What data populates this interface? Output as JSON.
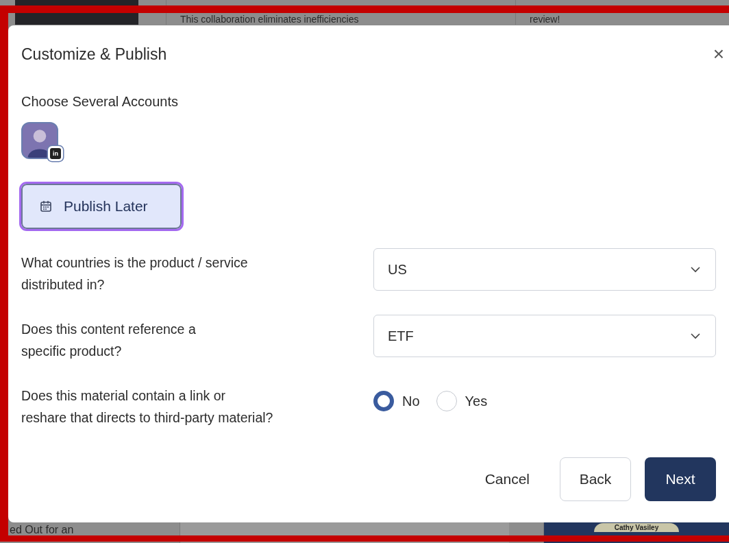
{
  "background": {
    "top_texts": [
      "This collaboration eliminates inefficiencies",
      "review!"
    ],
    "bottom_texts": [
      "ed Out for an",
      "Cathy Vasiley"
    ]
  },
  "dialog": {
    "title": "Customize & Publish",
    "close": "×",
    "accounts": {
      "label": "Choose Several Accounts",
      "items": [
        {
          "badge": "in",
          "selected": false
        }
      ]
    },
    "publish_later": {
      "label": "Publish Later",
      "focused": true
    },
    "questions": [
      {
        "kind": "select",
        "label_lines": [
          "What countries is the product / service",
          "distributed in?"
        ],
        "value": "US"
      },
      {
        "kind": "select",
        "label_lines": [
          "Does this content reference a",
          "specific product?"
        ],
        "value": "ETF"
      },
      {
        "kind": "radio",
        "label_lines": [
          "Does this material contain a link or",
          "reshare that directs to third-party material?"
        ],
        "options": [
          {
            "label": "No",
            "selected": true
          },
          {
            "label": "Yes",
            "selected": false
          }
        ]
      }
    ],
    "buttons": [
      {
        "kind": "text",
        "label": "Cancel"
      },
      {
        "kind": "outline",
        "label": "Back"
      },
      {
        "kind": "primary",
        "label": "Next"
      }
    ]
  }
}
